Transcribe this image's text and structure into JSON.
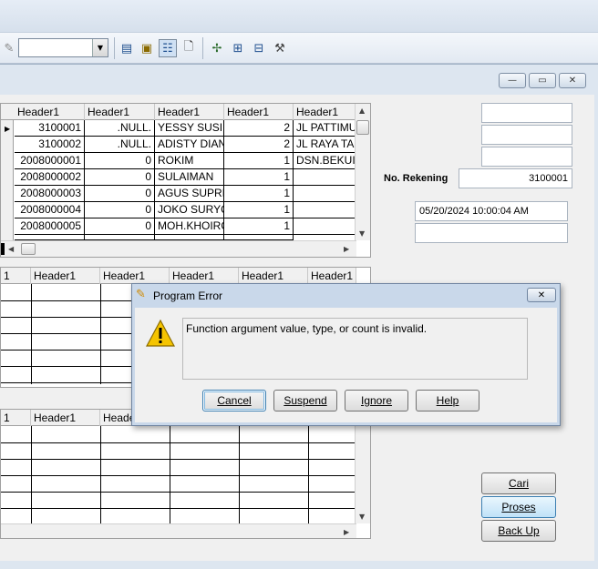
{
  "grid1": {
    "headers": [
      "Header1",
      "Header1",
      "Header1",
      "Header1",
      "Header1"
    ],
    "rows": [
      [
        "3100001",
        ".NULL.",
        "YESSY SUSIL",
        "2",
        "JL PATTIMU"
      ],
      [
        "3100002",
        ".NULL.",
        "ADISTY DIAN",
        "2",
        "JL RAYA TA"
      ],
      [
        "2008000001",
        "0",
        "ROKIM",
        "1",
        "DSN.BEKUI"
      ],
      [
        "2008000002",
        "0",
        "SULAIMAN",
        "1",
        ""
      ],
      [
        "2008000003",
        "0",
        "AGUS SUPRI",
        "1",
        ""
      ],
      [
        "2008000004",
        "0",
        "JOKO SURYC",
        "1",
        ""
      ],
      [
        "2008000005",
        "0",
        "MOH.KHOIRC",
        "1",
        ""
      ]
    ]
  },
  "grid2": {
    "headers": [
      "1",
      "Header1",
      "Header1",
      "Header1",
      "Header1",
      "Header1"
    ]
  },
  "grid3": {
    "headers": [
      "1",
      "Header1",
      "Heade"
    ]
  },
  "fields": {
    "no_rekening_label": "No. Rekening",
    "no_rekening_value": "3100001",
    "datetime_value": "05/20/2024 10:00:04 AM"
  },
  "buttons": {
    "cari": "Cari",
    "proses": "Proses",
    "backup": "Back Up"
  },
  "dialog": {
    "title": "Program Error",
    "message": "Function argument value, type, or count is invalid.",
    "cancel": "Cancel",
    "suspend": "Suspend",
    "ignore": "Ignore",
    "help": "Help"
  },
  "icons": {
    "toolbar": [
      "pencil-icon",
      "grid-view-icon",
      "form-icon",
      "properties-icon",
      "print-preview-icon",
      "code-icon",
      "edit-form-icon",
      "browse-icon",
      "tools-icon"
    ],
    "dialog_title": "foxpro-icon",
    "dialog_warning": "warning-icon"
  },
  "colors": {
    "focus_border": "#3c7fb1",
    "warning": "#f5c400"
  }
}
